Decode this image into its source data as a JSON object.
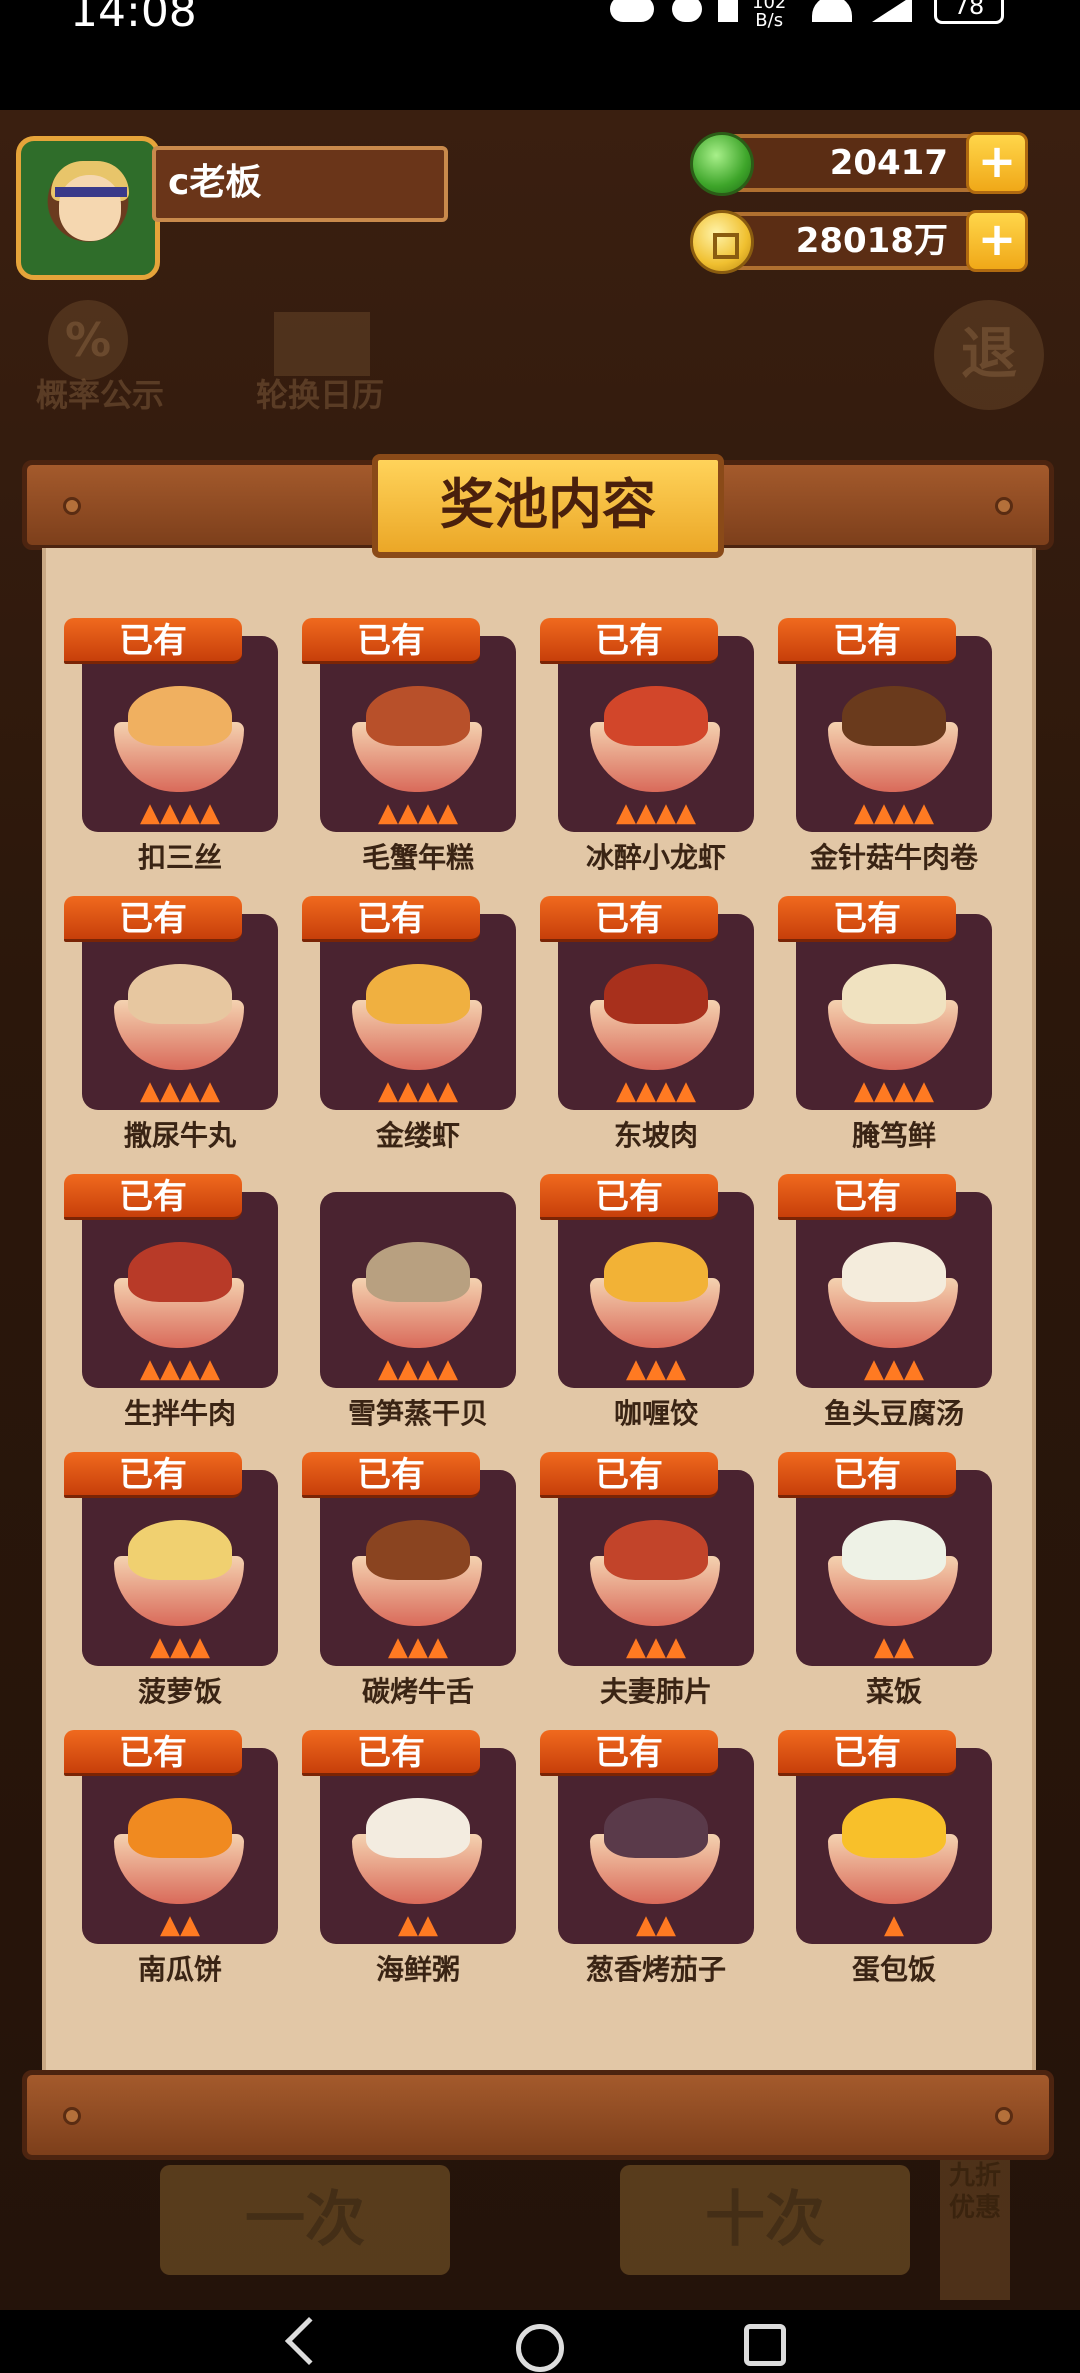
{
  "status_bar": {
    "time": "14:08",
    "net_speed_top": "102",
    "net_speed_unit": "B/s",
    "battery": "78"
  },
  "player": {
    "name": "c老板",
    "jade": "20417",
    "coins": "28018万",
    "plus_label": "+"
  },
  "background": {
    "probability_label": "概率公示",
    "calendar_label": "轮换日历",
    "exit_label": "退",
    "single_draw": "一次",
    "ten_draw": "十次",
    "promo": "九折优惠"
  },
  "panel": {
    "title": "奖池内容",
    "owned_label": "已有",
    "dishes": [
      {
        "name": "扣三丝",
        "owned": true,
        "stars": 4,
        "color": "#f0b060"
      },
      {
        "name": "毛蟹年糕",
        "owned": true,
        "stars": 4,
        "color": "#b8502a"
      },
      {
        "name": "冰醉小龙虾",
        "owned": true,
        "stars": 4,
        "color": "#d2462a"
      },
      {
        "name": "金针菇牛肉卷",
        "owned": true,
        "stars": 4,
        "color": "#6a3a1c"
      },
      {
        "name": "撒尿牛丸",
        "owned": true,
        "stars": 4,
        "color": "#e7c7a0"
      },
      {
        "name": "金缕虾",
        "owned": true,
        "stars": 4,
        "color": "#f0b040"
      },
      {
        "name": "东坡肉",
        "owned": true,
        "stars": 4,
        "color": "#a8301c"
      },
      {
        "name": "腌笃鲜",
        "owned": true,
        "stars": 4,
        "color": "#f0e2c0"
      },
      {
        "name": "生拌牛肉",
        "owned": true,
        "stars": 4,
        "color": "#b83a28"
      },
      {
        "name": "雪笋蒸干贝",
        "owned": false,
        "stars": 4,
        "color": "#b8a080"
      },
      {
        "name": "咖喱饺",
        "owned": true,
        "stars": 3,
        "color": "#f2b236"
      },
      {
        "name": "鱼头豆腐汤",
        "owned": true,
        "stars": 3,
        "color": "#f4ecdc"
      },
      {
        "name": "菠萝饭",
        "owned": true,
        "stars": 3,
        "color": "#f0d070"
      },
      {
        "name": "碳烤牛舌",
        "owned": true,
        "stars": 3,
        "color": "#8a4420"
      },
      {
        "name": "夫妻肺片",
        "owned": true,
        "stars": 3,
        "color": "#c2442a"
      },
      {
        "name": "菜饭",
        "owned": true,
        "stars": 2,
        "color": "#eef2e6"
      },
      {
        "name": "南瓜饼",
        "owned": true,
        "stars": 2,
        "color": "#f08a20"
      },
      {
        "name": "海鲜粥",
        "owned": true,
        "stars": 2,
        "color": "#f3ece0"
      },
      {
        "name": "葱香烤茄子",
        "owned": true,
        "stars": 2,
        "color": "#5a3a4a"
      },
      {
        "name": "蛋包饭",
        "owned": true,
        "stars": 1,
        "color": "#f8c02a"
      }
    ]
  }
}
